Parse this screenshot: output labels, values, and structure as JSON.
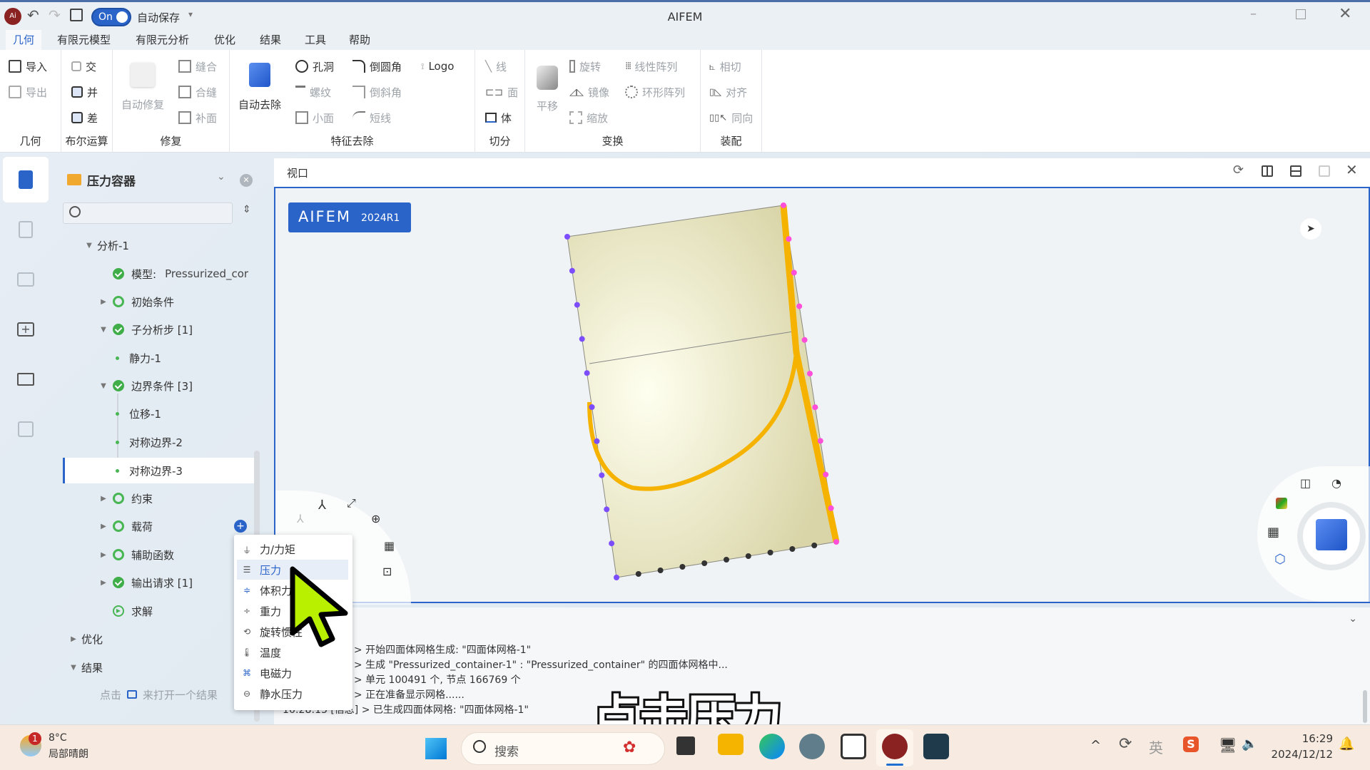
{
  "window": {
    "title": "AIFEM",
    "autosave_toggle": "On",
    "autosave_label": "自动保存"
  },
  "menu_tabs": [
    {
      "label": "几何",
      "active": true
    },
    {
      "label": "有限元模型"
    },
    {
      "label": "有限元分析"
    },
    {
      "label": "优化"
    },
    {
      "label": "结果"
    },
    {
      "label": "工具"
    },
    {
      "label": "帮助"
    }
  ],
  "ribbon": {
    "groups": {
      "geometry": {
        "title": "几何",
        "import": "导入",
        "export": "导出"
      },
      "boolean": {
        "title": "布尔运算",
        "intersect": "交",
        "union": "并",
        "subtract": "差"
      },
      "repair": {
        "title": "修复",
        "auto_repair": "自动修复",
        "stitch": "缝合",
        "merge_seam": "合缝",
        "patch": "补面"
      },
      "feature_removal": {
        "title": "特征去除",
        "auto_remove": "自动去除",
        "hole": "孔洞",
        "fillet": "倒圆角",
        "logo": "Logo",
        "thread": "螺纹",
        "chamfer": "倒斜角",
        "small_face": "小面",
        "short_line": "短线"
      },
      "split": {
        "title": "切分",
        "line": "线",
        "face": "面",
        "body": "体"
      },
      "transform": {
        "title": "变换",
        "translate": "平移",
        "rotate": "旋转",
        "linear_array": "线性阵列",
        "mirror": "镜像",
        "circular_array": "环形阵列",
        "scale": "缩放"
      },
      "assembly": {
        "title": "装配",
        "tangent": "相切",
        "align": "对齐",
        "same_direction": "同向"
      }
    }
  },
  "tree": {
    "project_title": "压力容器",
    "search_placeholder": "",
    "items": [
      {
        "label": "分析-1",
        "level": 0,
        "caret": "down"
      },
      {
        "label": "模型:",
        "value": "Pressurized_cor",
        "status": "ok"
      },
      {
        "label": "初始条件",
        "status": "empty",
        "caret": "right"
      },
      {
        "label": "子分析步 [1]",
        "status": "ok",
        "caret": "down"
      },
      {
        "label": "静力-1",
        "leaf": true
      },
      {
        "label": "边界条件 [3]",
        "status": "ok",
        "caret": "down"
      },
      {
        "label": "位移-1",
        "leaf": true
      },
      {
        "label": "对称边界-2",
        "leaf": true
      },
      {
        "label": "对称边界-3",
        "leaf": true,
        "selected": true
      },
      {
        "label": "约束",
        "status": "empty",
        "caret": "right"
      },
      {
        "label": "载荷",
        "status": "empty",
        "caret": "right"
      },
      {
        "label": "辅助函数",
        "status": "empty",
        "caret": "right"
      },
      {
        "label": "输出请求 [1]",
        "status": "ok",
        "caret": "right"
      },
      {
        "label": "求解",
        "status": "play"
      },
      {
        "label": "优化",
        "level": 0,
        "caret": "right"
      },
      {
        "label": "结果",
        "level": 0,
        "caret": "down"
      }
    ],
    "results_hint_prefix": "点击",
    "results_hint_suffix": "来打开一个结果"
  },
  "context_menu": {
    "items": [
      {
        "label": "力/力矩"
      },
      {
        "label": "压力",
        "selected": true
      },
      {
        "label": "体积力"
      },
      {
        "label": "重力"
      },
      {
        "label": "旋转惯性"
      },
      {
        "label": "温度"
      },
      {
        "label": "电磁力"
      },
      {
        "label": "静水压力"
      }
    ]
  },
  "viewport": {
    "title": "视口",
    "badge_name": "AIFEM",
    "badge_version": "2024R1"
  },
  "console": {
    "lines": [
      "] > 开始四面体网格生成: \"四面体网格-1\"",
      "] > 生成 \"Pressurized_container-1\" : \"Pressurized_container\" 的四面体网格中...",
      "] > 单元 100491 个, 节点 166769 个",
      "] > 正在准备显示网格......",
      "16:28:13 [信息] > 已生成四面体网格: \"四面体网格-1\""
    ]
  },
  "subtitle": "点击压力",
  "taskbar": {
    "weather_badge": "1",
    "weather_temp": "8°C",
    "weather_desc": "局部晴朗",
    "search_placeholder": "搜索",
    "ime_label": "英",
    "time": "16:29",
    "date": "2024/12/12"
  },
  "colors": {
    "accent": "#2b64c9",
    "ok": "#3fae49",
    "highlight_edge": "#f5b300",
    "model_fill": "#e5e2b8"
  }
}
